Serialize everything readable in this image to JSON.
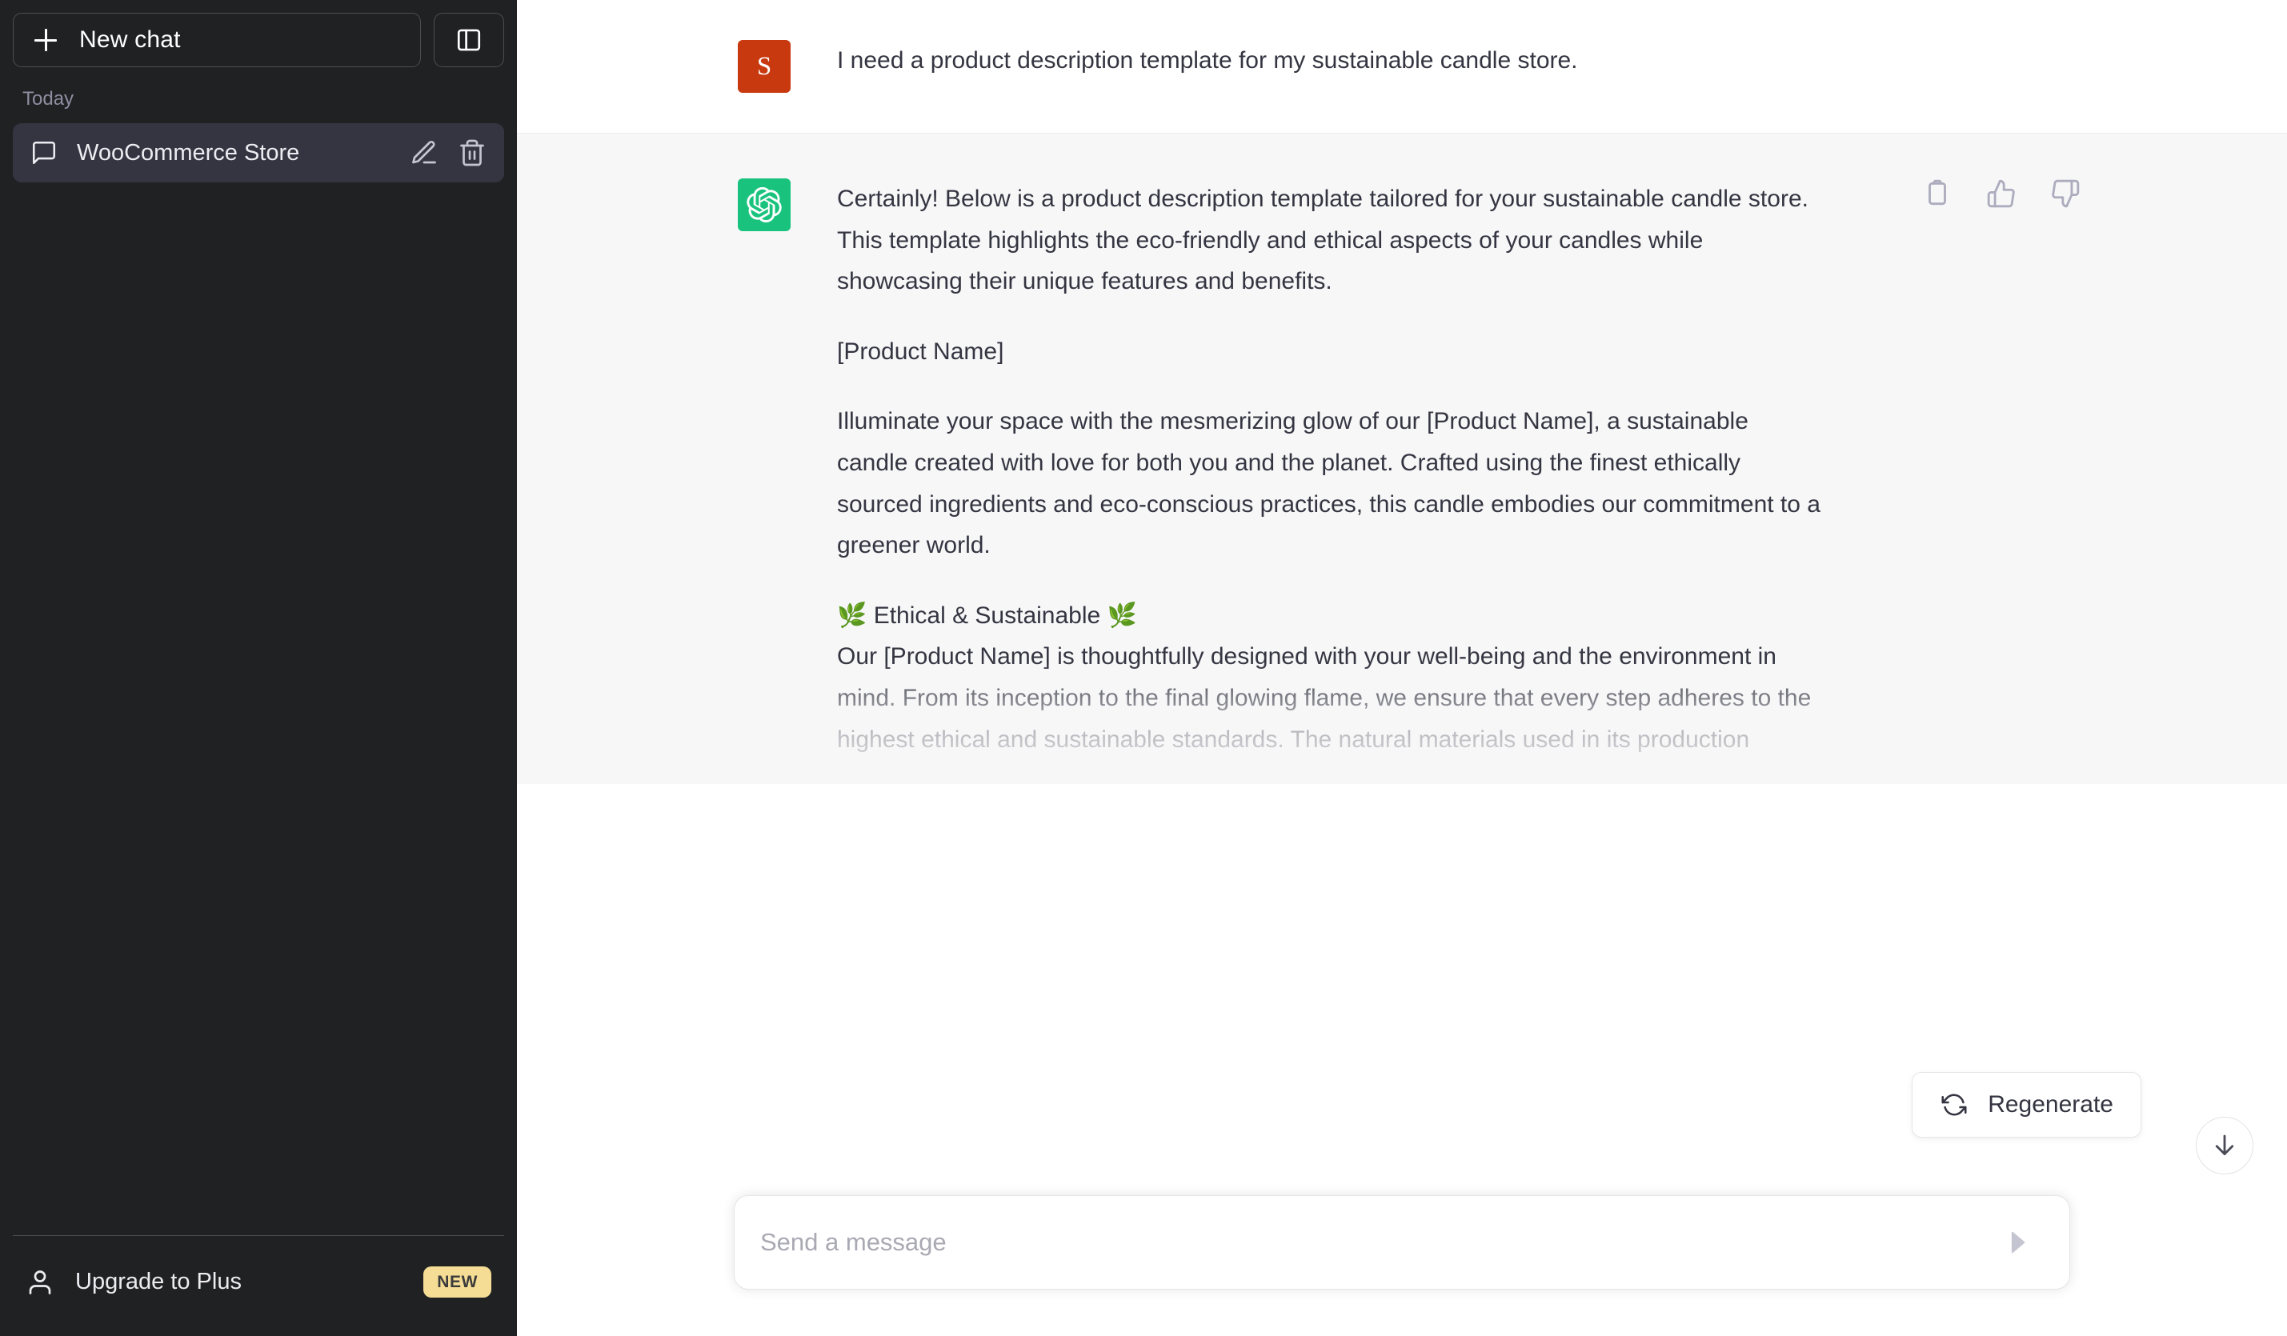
{
  "sidebar": {
    "new_chat_label": "New chat",
    "toggle_icon": "sidebar-panel-icon",
    "section_label": "Today",
    "chats": [
      {
        "title": "WooCommerce Store",
        "icon": "message-square-icon",
        "edit_icon": "pencil-icon",
        "delete_icon": "trash-icon",
        "active": true
      }
    ],
    "upgrade": {
      "label": "Upgrade to Plus",
      "icon": "user-icon",
      "badge": "NEW",
      "badge_color": "#f5dd95"
    },
    "background_color": "#202123",
    "active_item_color": "#343541"
  },
  "conversation": {
    "messages": [
      {
        "role": "user",
        "avatar_letter": "S",
        "avatar_color": "#c8390f",
        "paragraphs": [
          "I need a product description template for my sustainable candle store."
        ]
      },
      {
        "role": "assistant",
        "avatar_icon": "openai-logo-icon",
        "avatar_color": "#19c37d",
        "paragraphs": [
          "Certainly! Below is a product description template tailored for your sustainable candle store. This template highlights the eco-friendly and ethical aspects of your candles while showcasing their unique features and benefits.",
          "[Product Name]",
          "Illuminate your space with the mesmerizing glow of our [Product Name], a sustainable candle created with love for both you and the planet. Crafted using the finest ethically sourced ingredients and eco-conscious practices, this candle embodies our commitment to a greener world."
        ],
        "section_heading": "🌿 Ethical & Sustainable 🌿",
        "section_body": "Our [Product Name] is thoughtfully designed with your well-being and the environment in mind. From its inception to the final glowing flame, we ensure that every step adheres to the highest ethical and sustainable standards. The natural materials used in its production",
        "tools": [
          {
            "name": "copy-icon",
            "label": "Copy"
          },
          {
            "name": "thumbs-up-icon",
            "label": "Good response"
          },
          {
            "name": "thumbs-down-icon",
            "label": "Bad response"
          }
        ]
      }
    ]
  },
  "composer": {
    "placeholder": "Send a message",
    "value": "",
    "send_icon": "send-arrow-icon"
  },
  "regenerate": {
    "label": "Regenerate",
    "icon": "refresh-icon"
  },
  "scroll_bottom": {
    "icon": "arrow-down-icon"
  }
}
